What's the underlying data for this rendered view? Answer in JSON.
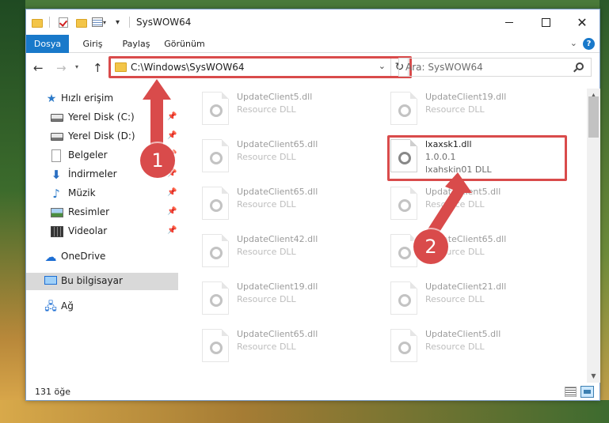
{
  "title": "SysWOW64",
  "tabs": {
    "file": "Dosya",
    "home": "Giriş",
    "share": "Paylaş",
    "view": "Görünüm"
  },
  "address": "C:\\Windows\\SysWOW64",
  "search_placeholder": "Ara: SysWOW64",
  "sidebar": {
    "quick_access": "Hızlı erişim",
    "items": [
      "Yerel Disk (C:)",
      "Yerel Disk (D:)",
      "Belgeler",
      "İndirmeler",
      "Müzik",
      "Resimler",
      "Videolar"
    ],
    "onedrive": "OneDrive",
    "this_pc": "Bu bilgisayar",
    "network": "Ağ"
  },
  "files": [
    {
      "name": "UpdateClient5.dll",
      "type": "Resource DLL"
    },
    {
      "name": "UpdateClient19.dll",
      "type": "Resource DLL"
    },
    {
      "name": "UpdateClient65.dll",
      "type": "Resource DLL"
    },
    {
      "name": "lxaxsk1.dll",
      "version": "1.0.0.1",
      "type": "lxahskin01 DLL"
    },
    {
      "name": "UpdateClient65.dll",
      "type": "Resource DLL"
    },
    {
      "name": "UpdateClient5.dll",
      "type": "Resource DLL"
    },
    {
      "name": "UpdateClient42.dll",
      "type": "Resource DLL"
    },
    {
      "name": "UpdateClient65.dll",
      "type": "Resource DLL"
    },
    {
      "name": "UpdateClient19.dll",
      "type": "Resource DLL"
    },
    {
      "name": "UpdateClient21.dll",
      "type": "Resource DLL"
    },
    {
      "name": "UpdateClient65.dll",
      "type": "Resource DLL"
    },
    {
      "name": "UpdateClient5.dll",
      "type": "Resource DLL"
    }
  ],
  "status": "131 öğe",
  "annotations": {
    "step1": "1",
    "step2": "2",
    "color": "#d94b4b"
  }
}
